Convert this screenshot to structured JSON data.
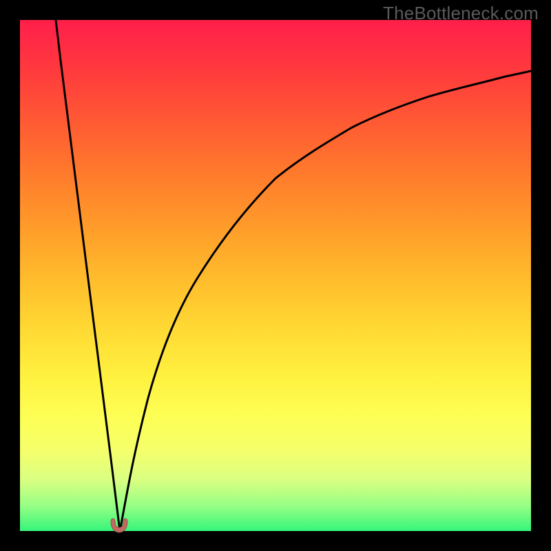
{
  "watermark": "TheBottleneck.com",
  "colors": {
    "frame_border": "#000000",
    "curve_stroke": "#000000",
    "marker_fill": "#c16a63",
    "gradient_top": "#ff1f4b",
    "gradient_bottom": "#35f57b"
  },
  "chart_data": {
    "type": "line",
    "title": "",
    "xlabel": "",
    "ylabel": "",
    "xlim": [
      0,
      100
    ],
    "ylim": [
      0,
      100
    ],
    "grid": false,
    "legend_position": "none",
    "background": "vertical-gradient",
    "notes": "Two V-shaped curves meeting near x≈19.5 at y≈0. Left branch rises steeply to top-left; right branch rises with decreasing slope toward top-right (~y≈90 at x=100). Small cup-shaped marker sits at the minimum.",
    "series": [
      {
        "name": "left-branch",
        "x": [
          7,
          8,
          10,
          12,
          14,
          16,
          18,
          19.5
        ],
        "values": [
          100,
          92,
          76,
          60,
          44,
          28,
          12,
          0
        ]
      },
      {
        "name": "right-branch",
        "x": [
          19.5,
          22,
          25,
          30,
          35,
          40,
          45,
          50,
          55,
          60,
          65,
          70,
          75,
          80,
          85,
          90,
          95,
          100
        ],
        "values": [
          0,
          14,
          26,
          40,
          50,
          58,
          64,
          69,
          73,
          76,
          79,
          81.5,
          83.5,
          85,
          86.5,
          88,
          89,
          90
        ]
      }
    ],
    "marker": {
      "x": 19.5,
      "y": 0
    }
  }
}
